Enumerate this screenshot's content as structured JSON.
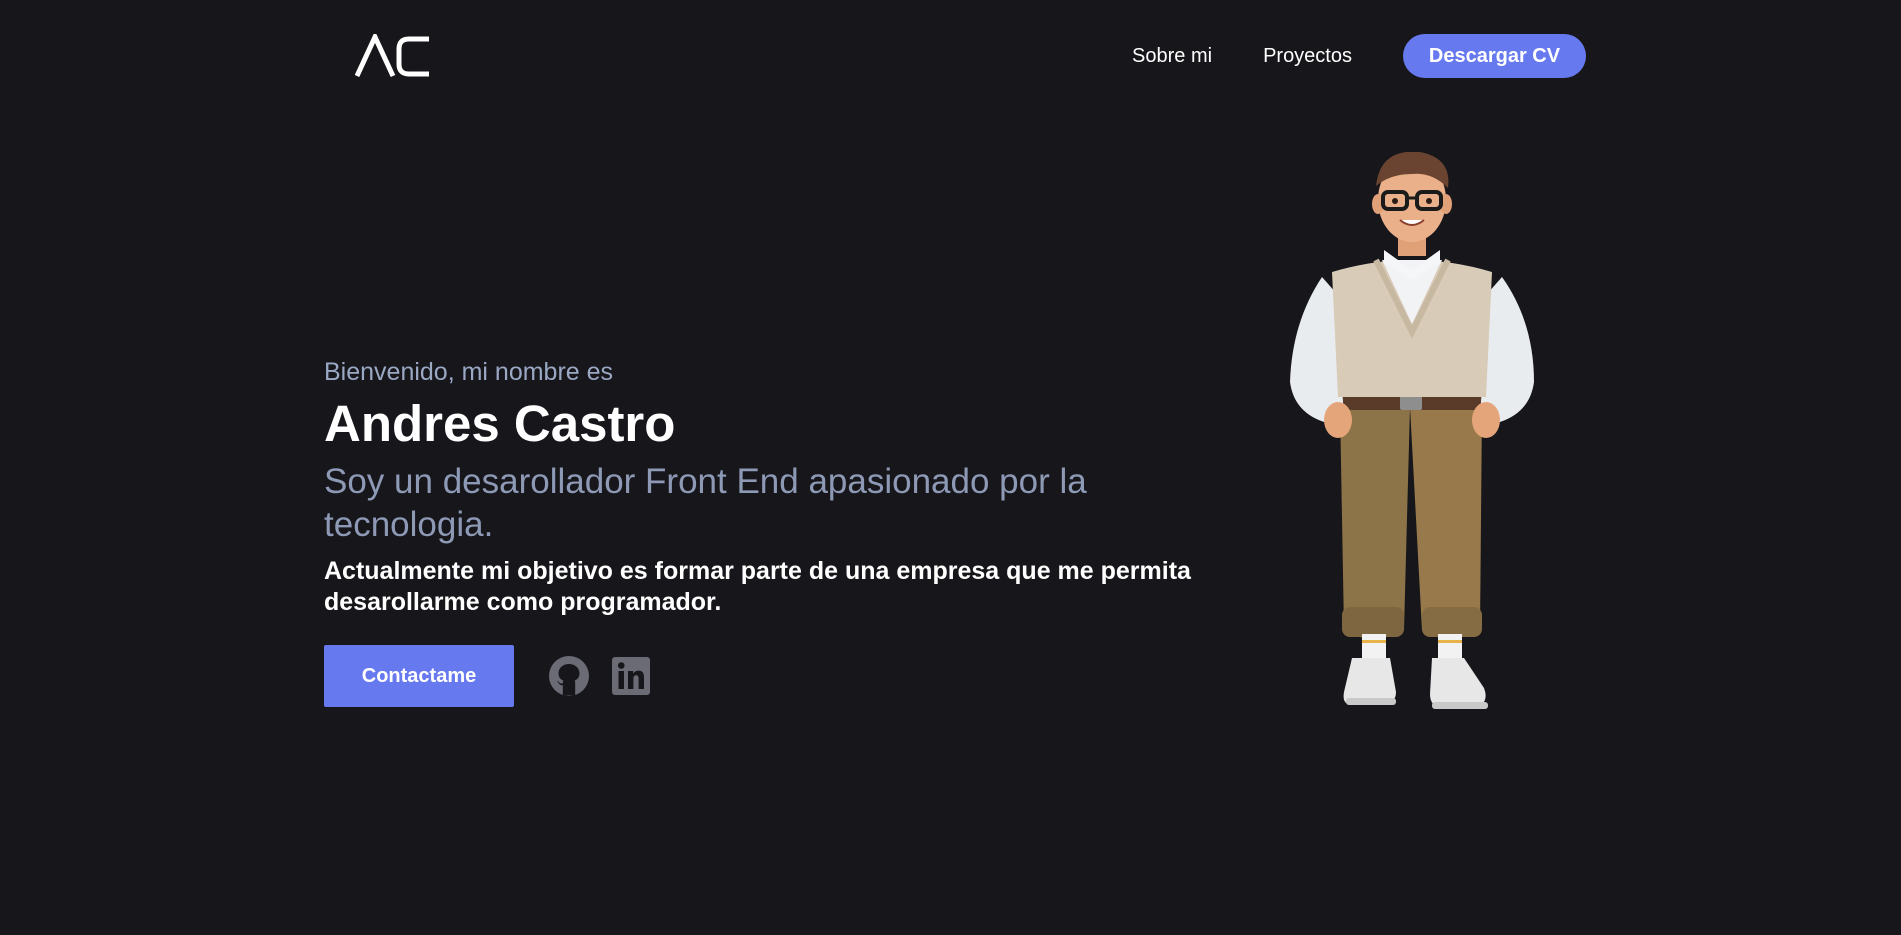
{
  "header": {
    "logo_text": "AC",
    "nav": {
      "about_label": "Sobre mi",
      "projects_label": "Proyectos",
      "cv_button_label": "Descargar CV"
    }
  },
  "hero": {
    "greeting": "Bienvenido, mi nombre es",
    "name": "Andres Castro",
    "tagline": "Soy un desarollador Front End apasionado por la tecnologia.",
    "objective": "Actualmente mi objetivo es formar parte de una empresa que me permita desarollarme como programador.",
    "contact_button_label": "Contactame",
    "social_links": [
      {
        "icon": "github-icon"
      },
      {
        "icon": "linkedin-icon"
      }
    ]
  },
  "colors": {
    "background": "#16161b",
    "accent": "#6779ef",
    "muted_text": "#8d99b5",
    "icon_gray": "#6b6b75"
  }
}
